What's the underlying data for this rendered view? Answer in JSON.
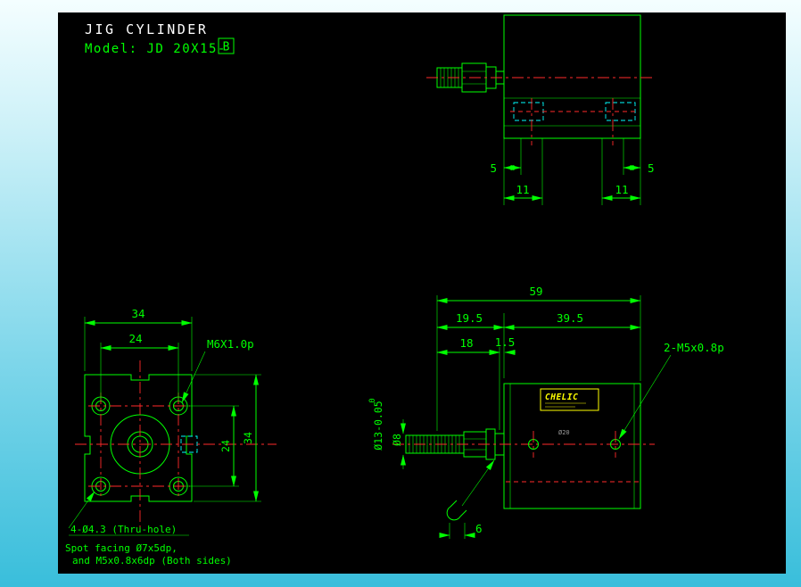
{
  "title": {
    "product": "JIG CYLINDER",
    "model_label": "Model: JD 20X15-",
    "model_option": "B"
  },
  "top_view": {
    "dim_5_left": "5",
    "dim_5_right": "5",
    "dim_11_left": "11",
    "dim_11_right": "11"
  },
  "front_view": {
    "dim_34_top": "34",
    "dim_24_top": "24",
    "dim_24_right": "24",
    "dim_34_right": "34",
    "thread_label": "M6X1.0p",
    "note_line1": "4-Ø4.3 (Thru-hole)",
    "note_line2": "Spot facing Ø7x5dp,",
    "note_line3": "and M5x0.8x6dp (Both sides)"
  },
  "side_view": {
    "dim_59": "59",
    "dim_19_5": "19.5",
    "dim_39_5": "39.5",
    "dim_18": "18",
    "dim_1_5": "1.5",
    "dim_6": "6",
    "port_label": "2-M5x0.8p",
    "rod_dia_label": "Ø13-0.05",
    "rod_tol_upper": "0",
    "thread_dia_label": "Ø8",
    "bore_label": "Ø20",
    "nameplate_brand": "CHELIC"
  },
  "colors": {
    "geometry": "#00ff00",
    "centerline": "#ff2a2a",
    "hidden": "#00ffff",
    "nameplate": "#ffff00",
    "title_text": "#ffffff",
    "canvas": "#000000"
  }
}
